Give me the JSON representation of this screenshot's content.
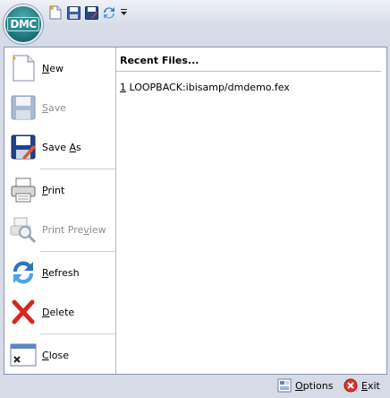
{
  "app": {
    "logo_text": "DMC"
  },
  "quick_access": [
    {
      "icon": "new-doc-icon"
    },
    {
      "icon": "save-icon"
    },
    {
      "icon": "save-as-icon"
    },
    {
      "icon": "refresh-icon"
    },
    {
      "icon": "dropdown-arrow-icon"
    }
  ],
  "menu": {
    "items": [
      {
        "label": "New",
        "accel": "N",
        "rest": "ew",
        "enabled": true,
        "icon": "new-doc-icon"
      },
      {
        "label": "Save",
        "accel": "S",
        "rest": "ave",
        "enabled": false,
        "icon": "save-icon"
      },
      {
        "label": "Save As",
        "pre": "Save ",
        "accel": "A",
        "rest": "s",
        "enabled": true,
        "icon": "save-as-icon"
      },
      {
        "label": "Print",
        "accel": "P",
        "rest": "rint",
        "enabled": true,
        "icon": "printer-icon"
      },
      {
        "label": "Print Preview",
        "pre": "Print Pre",
        "accel": "v",
        "rest": "iew",
        "enabled": false,
        "icon": "print-preview-icon"
      },
      {
        "label": "Refresh",
        "accel": "R",
        "rest": "efresh",
        "enabled": true,
        "icon": "refresh-icon"
      },
      {
        "label": "Delete",
        "accel": "D",
        "rest": "elete",
        "enabled": true,
        "icon": "delete-x-icon"
      },
      {
        "label": "Close",
        "accel": "C",
        "rest": "lose",
        "enabled": true,
        "icon": "close-window-icon"
      }
    ]
  },
  "recent": {
    "title": "Recent Files...",
    "items": [
      {
        "num": "1",
        "path": " LOOPBACK:ibisamp/dmdemo.fex"
      }
    ]
  },
  "footer": {
    "options": {
      "accel": "O",
      "rest": "ptions"
    },
    "exit": {
      "accel": "E",
      "rest": "xit"
    }
  }
}
